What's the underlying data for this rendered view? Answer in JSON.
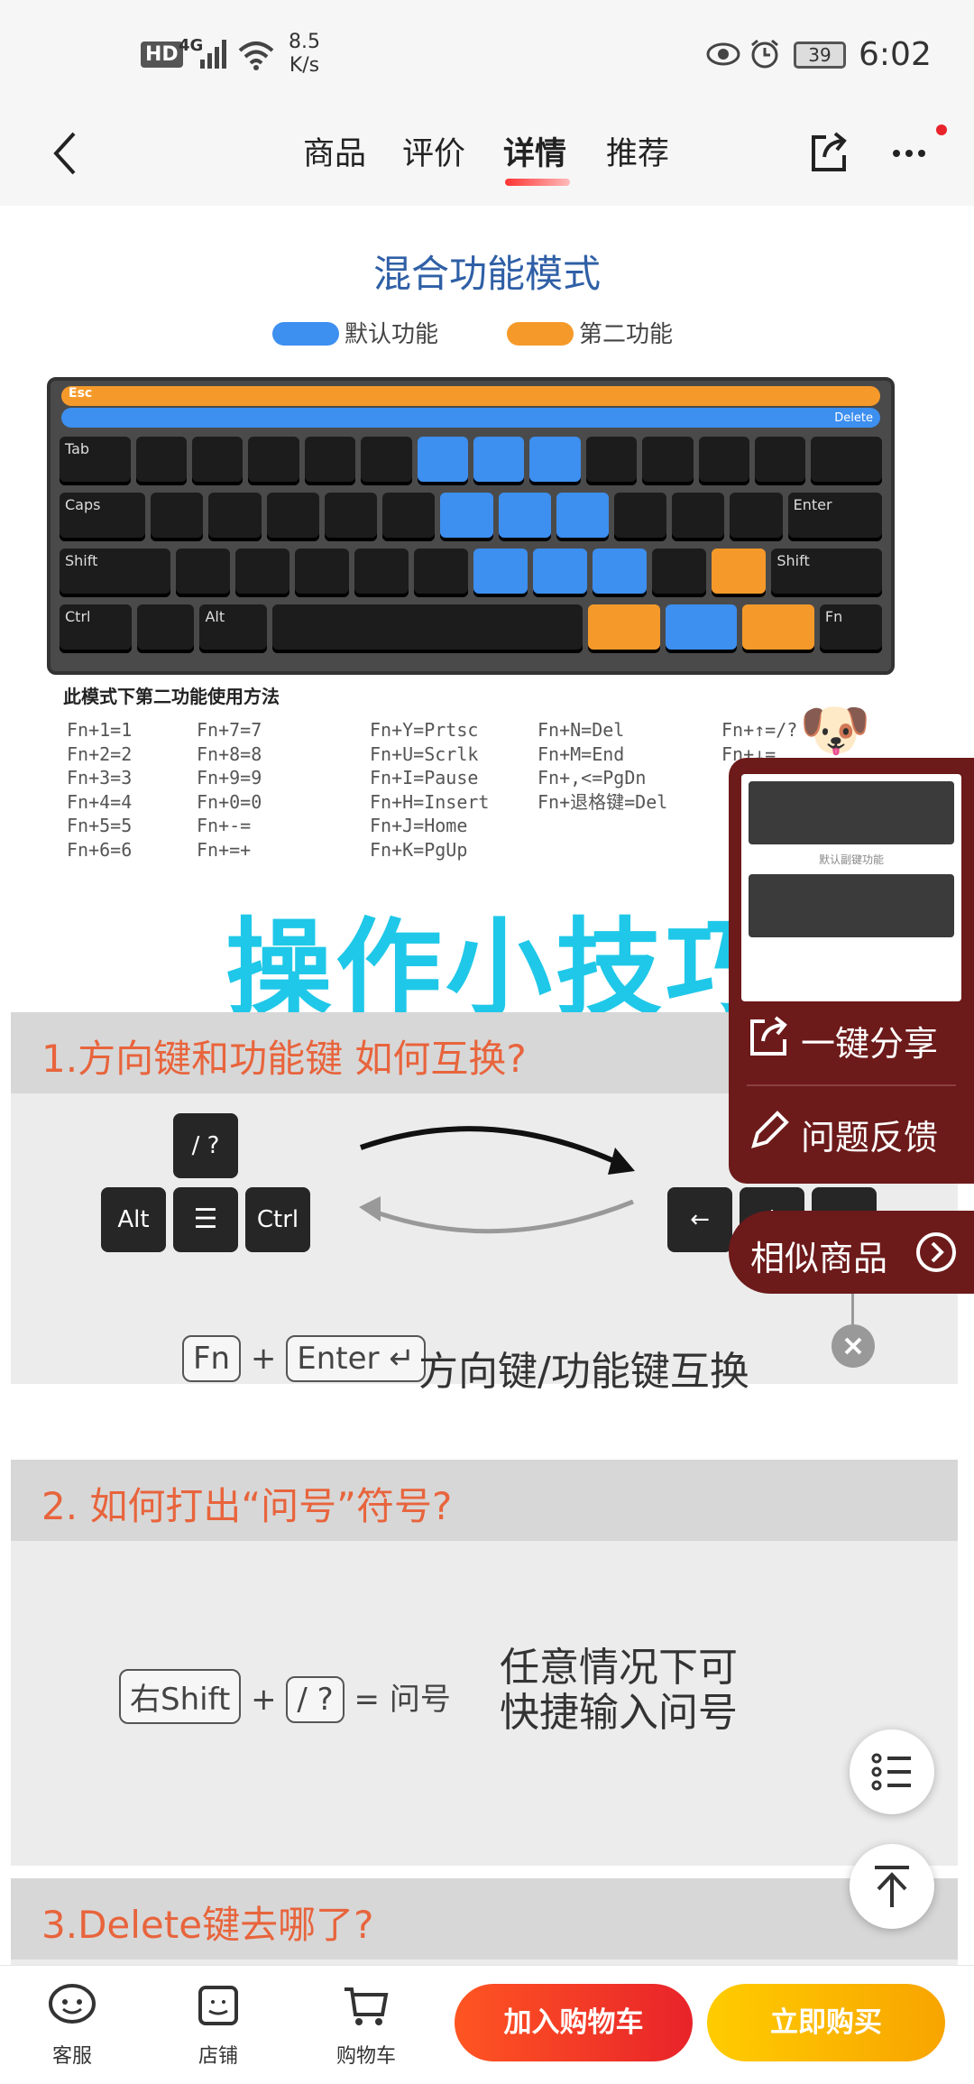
{
  "status": {
    "speed": "8.5",
    "speed_unit": "K/s",
    "net": "4G",
    "hd": "HD",
    "battery": "39",
    "time": "6:02"
  },
  "header": {
    "tabs": [
      "商品",
      "评价",
      "详情",
      "推荐"
    ],
    "active": 2
  },
  "pic1": {
    "title": "混合功能模式",
    "legend_default": "默认功能",
    "legend_second": "第二功能",
    "method_title": "此模式下第二功能使用方法",
    "col1": "Fn+1=1\nFn+2=2\nFn+3=3\nFn+4=4\nFn+5=5\nFn+6=6",
    "col2": "Fn+7=7\nFn+8=8\nFn+9=9\nFn+0=0\nFn+-=\nFn+=+",
    "col3": "Fn+Y=Prtsc\nFn+U=Scrlk\nFn+I=Pause\nFn+H=Insert\nFn+J=Home\nFn+K=PgUp",
    "col4": "Fn+N=Del\nFn+M=End\nFn+,<=PgDn\nFn+退格键=Del",
    "col5": "Fn+↑=/?\nFn+↓=",
    "keys": {
      "esc": "Esc",
      "tab": "Tab",
      "caps": "Caps",
      "shift": "Shift",
      "ctrl": "Ctrl",
      "alt": "Alt",
      "enter": "Enter",
      "fn": "Fn",
      "delete": "Delete"
    }
  },
  "tips_title": "操作小技巧",
  "sec1": {
    "title": "1.方向键和功能键 如何互换?",
    "k_slash": "/ ?",
    "k_alt": "Alt",
    "k_ctrl": "Ctrl",
    "k_left": "←",
    "k_down": "↓",
    "k_right": "→",
    "fn": "Fn",
    "plus": "+",
    "enter": "Enter ↵",
    "desc": "方向键/功能键互换"
  },
  "sec2": {
    "title": "2. 如何打出“问号”符号?",
    "k1": "右Shift",
    "plus": "+",
    "k2": "/ ?",
    "eq": "= 问号",
    "line1": "任意情况下可",
    "line2": "快捷输入问号"
  },
  "sec3": {
    "title": "3.Delete键去哪了?"
  },
  "float": {
    "share": "一键分享",
    "feedback": "问题反馈",
    "similar": "相似商品",
    "thumb_title": "默认副键功能"
  },
  "bottom": {
    "service": "客服",
    "shop": "店铺",
    "cart": "购物车",
    "add_cart": "加入购物车",
    "buy": "立即购买"
  },
  "colors": {
    "blue": "#3d8ff0",
    "orange": "#f59a2a",
    "red": "#e8232a",
    "yellow": "#f8b400",
    "tips": "#1fc8e8",
    "sec_title": "#e8643c"
  }
}
